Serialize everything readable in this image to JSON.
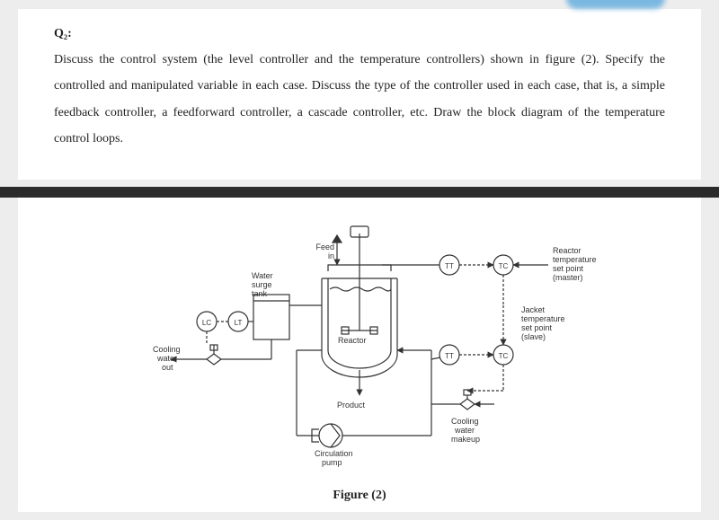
{
  "q": {
    "label": "Q₂:",
    "text": "Discuss the control system (the level controller and the temperature controllers) shown in figure (2). Specify the controlled and manipulated variable in each case. Discuss the type of the controller used in each case, that is, a simple feedback controller, a feedforward controller, a cascade controller, etc. Draw the block diagram of the temperature control loops."
  },
  "caption": "Figure (2)",
  "lbl": {
    "feed": "Feed",
    "in": "in",
    "water": "Water",
    "surge": "surge",
    "tank": "tank",
    "cooling_out1": "Cooling",
    "cooling_out2": "water",
    "cooling_out3": "out",
    "reactor": "Reactor",
    "product": "Product",
    "circ1": "Circulation",
    "circ2": "pump",
    "cool_in1": "Cooling",
    "cool_in2": "water",
    "cool_in3": "makeup",
    "rsp1": "Reactor",
    "rsp2": "temperature",
    "rsp3": "set point",
    "rsp4": "(master)",
    "jsp1": "Jacket",
    "jsp2": "temperature",
    "jsp3": "set point",
    "jsp4": "(slave)"
  },
  "inst": {
    "LC": "LC",
    "LT": "LT",
    "TT": "TT",
    "TC": "TC"
  }
}
